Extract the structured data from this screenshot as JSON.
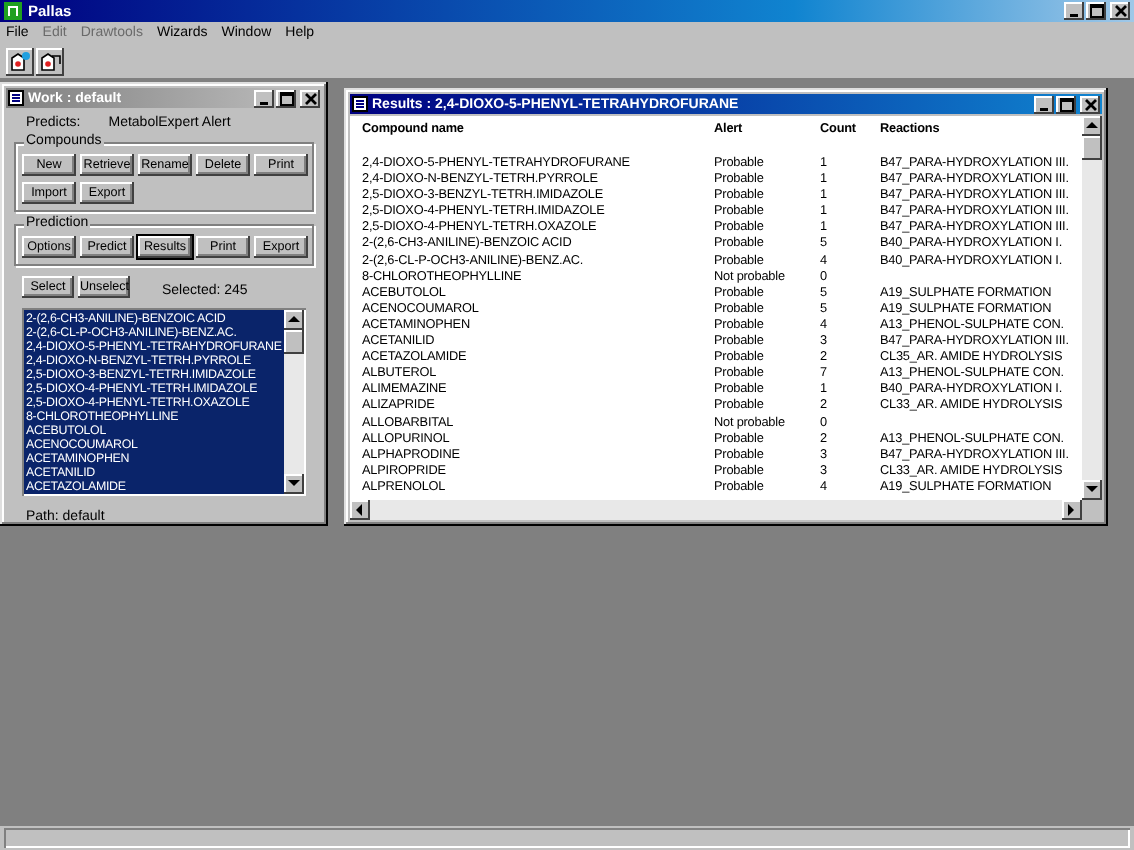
{
  "app": {
    "title": "Pallas"
  },
  "menu": [
    {
      "label": "File",
      "disabled": false
    },
    {
      "label": "Edit",
      "disabled": true
    },
    {
      "label": "Drawtools",
      "disabled": true
    },
    {
      "label": "Wizards",
      "disabled": false
    },
    {
      "label": "Window",
      "disabled": false
    },
    {
      "label": "Help",
      "disabled": false
    }
  ],
  "work_window": {
    "title": "Work : default",
    "active": false,
    "predicts_label": "Predicts:",
    "predicts_value": "MetabolExpert Alert",
    "groups": [
      {
        "title": "Compounds",
        "buttons": [
          {
            "label": "New",
            "focused": false
          },
          {
            "label": "Retrieve",
            "focused": false
          },
          {
            "label": "Rename",
            "focused": false
          },
          {
            "label": "Delete",
            "focused": false
          },
          {
            "label": "Print",
            "focused": false
          },
          {
            "label": "Import",
            "focused": false
          },
          {
            "label": "Export",
            "focused": false
          }
        ]
      },
      {
        "title": "Prediction",
        "buttons": [
          {
            "label": "Options",
            "focused": false
          },
          {
            "label": "Predict",
            "focused": false
          },
          {
            "label": "Results",
            "focused": true
          },
          {
            "label": "Print",
            "focused": false
          },
          {
            "label": "Export",
            "focused": false
          }
        ]
      }
    ],
    "selection_buttons": [
      {
        "label": "Select",
        "focused": false
      },
      {
        "label": "Unselect",
        "focused": false
      }
    ],
    "selected_count": "Selected: 245",
    "compounds": [
      {
        "name": "2-(2,6-CH3-ANILINE)-BENZOIC ACID",
        "selected": true
      },
      {
        "name": "2-(2,6-CL-P-OCH3-ANILINE)-BENZ.AC.",
        "selected": true
      },
      {
        "name": "2,4-DIOXO-5-PHENYL-TETRAHYDROFURANE",
        "selected": true
      },
      {
        "name": "2,4-DIOXO-N-BENZYL-TETRH.PYRROLE",
        "selected": true
      },
      {
        "name": "2,5-DIOXO-3-BENZYL-TETRH.IMIDAZOLE",
        "selected": true
      },
      {
        "name": "2,5-DIOXO-4-PHENYL-TETRH.IMIDAZOLE",
        "selected": true
      },
      {
        "name": "2,5-DIOXO-4-PHENYL-TETRH.OXAZOLE",
        "selected": true
      },
      {
        "name": "8-CHLOROTHEOPHYLLINE",
        "selected": true
      },
      {
        "name": "ACEBUTOLOL",
        "selected": true
      },
      {
        "name": "ACENOCOUMAROL",
        "selected": true
      },
      {
        "name": "ACETAMINOPHEN",
        "selected": true
      },
      {
        "name": "ACETANILID",
        "selected": true
      },
      {
        "name": "ACETAZOLAMIDE",
        "selected": true
      }
    ],
    "path": "Path: default"
  },
  "results_window": {
    "title": "Results : 2,4-DIOXO-5-PHENYL-TETRAHYDROFURANE",
    "active": true,
    "columns": [
      "Compound name",
      "Alert",
      "Count",
      "Reactions"
    ],
    "rows": [
      {
        "compound": "2,4-DIOXO-5-PHENYL-TETRAHYDROFURANE",
        "alert": "Probable",
        "count": "1",
        "reaction": "B47_PARA-HYDROXYLATION III."
      },
      {
        "compound": "2,4-DIOXO-N-BENZYL-TETRH.PYRROLE",
        "alert": "Probable",
        "count": "1",
        "reaction": "B47_PARA-HYDROXYLATION III."
      },
      {
        "compound": "2,5-DIOXO-3-BENZYL-TETRH.IMIDAZOLE",
        "alert": "Probable",
        "count": "1",
        "reaction": "B47_PARA-HYDROXYLATION III."
      },
      {
        "compound": "2,5-DIOXO-4-PHENYL-TETRH.IMIDAZOLE",
        "alert": "Probable",
        "count": "1",
        "reaction": "B47_PARA-HYDROXYLATION III."
      },
      {
        "compound": "2,5-DIOXO-4-PHENYL-TETRH.OXAZOLE",
        "alert": "Probable",
        "count": "1",
        "reaction": "B47_PARA-HYDROXYLATION III."
      },
      {
        "compound": "2-(2,6-CH3-ANILINE)-BENZOIC ACID",
        "alert": "Probable",
        "count": "5",
        "reaction": "B40_PARA-HYDROXYLATION I."
      },
      {
        "compound": "2-(2,6-CL-P-OCH3-ANILINE)-BENZ.AC.",
        "alert": "Probable",
        "count": "4",
        "reaction": "B40_PARA-HYDROXYLATION I."
      },
      {
        "compound": "8-CHLOROTHEOPHYLLINE",
        "alert": "Not probable",
        "count": "0"
      },
      {
        "compound": "ACEBUTOLOL",
        "alert": "Probable",
        "count": "5",
        "reaction": "A19_SULPHATE FORMATION"
      },
      {
        "compound": "ACENOCOUMAROL",
        "alert": "Probable",
        "count": "5",
        "reaction": "A19_SULPHATE FORMATION"
      },
      {
        "compound": "ACETAMINOPHEN",
        "alert": "Probable",
        "count": "4",
        "reaction": "A13_PHENOL-SULPHATE CON."
      },
      {
        "compound": "ACETANILID",
        "alert": "Probable",
        "count": "3",
        "reaction": "B47_PARA-HYDROXYLATION III."
      },
      {
        "compound": "ACETAZOLAMIDE",
        "alert": "Probable",
        "count": "2",
        "reaction": "CL35_AR. AMIDE HYDROLYSIS"
      },
      {
        "compound": "ALBUTEROL",
        "alert": "Probable",
        "count": "7",
        "reaction": "A13_PHENOL-SULPHATE CON."
      },
      {
        "compound": "ALIMEMAZINE",
        "alert": "Probable",
        "count": "1",
        "reaction": "B40_PARA-HYDROXYLATION I."
      },
      {
        "compound": "ALIZAPRIDE",
        "alert": "Probable",
        "count": "2",
        "reaction": "CL33_AR. AMIDE HYDROLYSIS"
      },
      {
        "compound": "ALLOBARBITAL",
        "alert": "Not probable",
        "count": "0"
      },
      {
        "compound": "ALLOPURINOL",
        "alert": "Probable",
        "count": "2",
        "reaction": "A13_PHENOL-SULPHATE CON."
      },
      {
        "compound": "ALPHAPRODINE",
        "alert": "Probable",
        "count": "3",
        "reaction": "B47_PARA-HYDROXYLATION III."
      },
      {
        "compound": "ALPIROPRIDE",
        "alert": "Probable",
        "count": "3",
        "reaction": "CL33_AR. AMIDE HYDROLYSIS"
      },
      {
        "compound": "ALPRENOLOL",
        "alert": "Probable",
        "count": "4",
        "reaction": "A19_SULPHATE FORMATION"
      }
    ]
  }
}
